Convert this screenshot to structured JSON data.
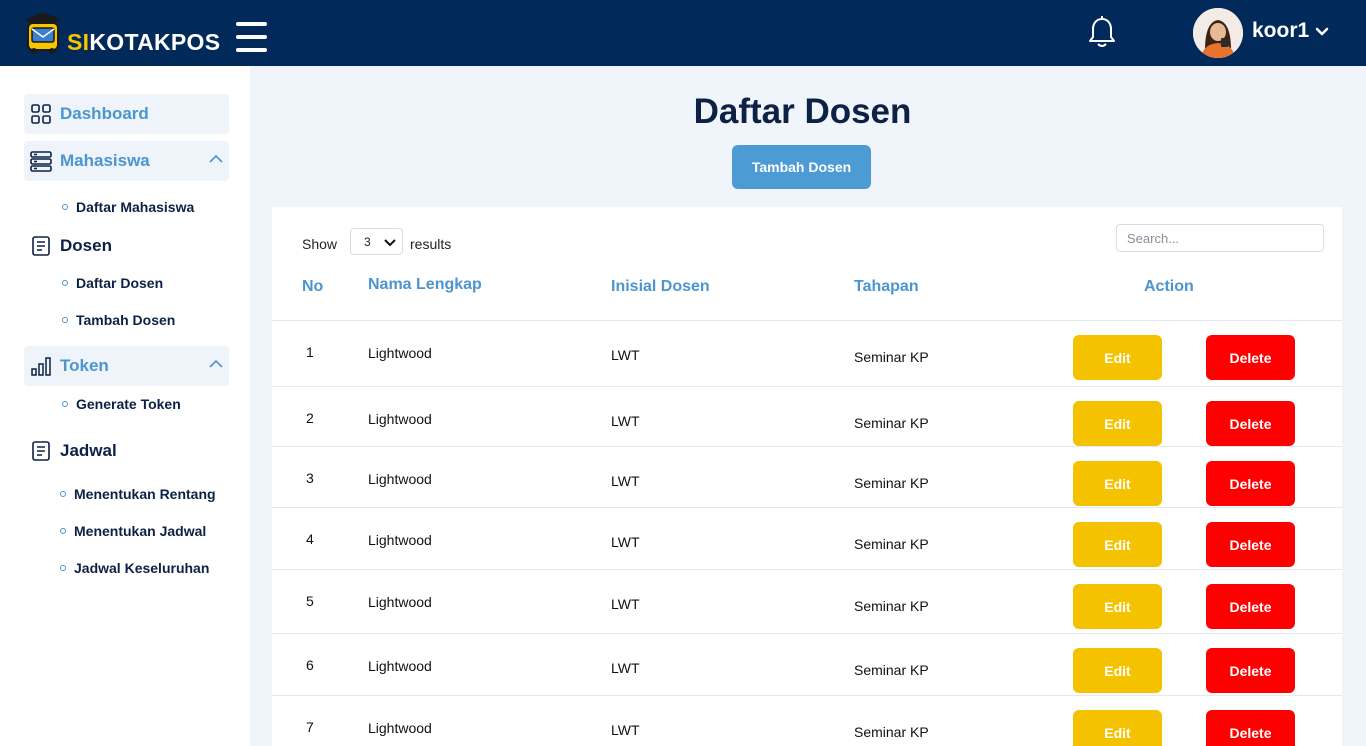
{
  "header": {
    "brand_prefix": "SI",
    "brand_suffix": "KOTAKPOS",
    "username": "koor1",
    "colors": {
      "bar": "#012a5a",
      "brand_accent": "#f7c600"
    }
  },
  "sidebar": {
    "dashboard": "Dashboard",
    "mahasiswa": "Mahasiswa",
    "mahasiswa_sub": [
      "Daftar Mahasiswa"
    ],
    "dosen": "Dosen",
    "dosen_sub": [
      "Daftar Dosen",
      "Tambah Dosen"
    ],
    "token": "Token",
    "token_sub": [
      "Generate Token"
    ],
    "jadwal": "Jadwal",
    "jadwal_sub": [
      "Menentukan Rentang",
      "Menentukan Jadwal",
      "Jadwal Keseluruhan"
    ]
  },
  "main": {
    "title": "Daftar Dosen",
    "add_button": "Tambah Dosen",
    "show_label": "Show",
    "page_size": "3",
    "results_label": "results",
    "search_placeholder": "Search...",
    "columns": [
      "No",
      "Nama Lengkap",
      "Inisial Dosen",
      "Tahapan",
      "Action"
    ],
    "edit_label": "Edit",
    "delete_label": "Delete",
    "rows": [
      {
        "no": "1",
        "nama": "Lightwood",
        "inisial": "LWT",
        "tahapan": "Seminar KP"
      },
      {
        "no": "2",
        "nama": "Lightwood",
        "inisial": "LWT",
        "tahapan": "Seminar KP"
      },
      {
        "no": "3",
        "nama": "Lightwood",
        "inisial": "LWT",
        "tahapan": "Seminar KP"
      },
      {
        "no": "4",
        "nama": "Lightwood",
        "inisial": "LWT",
        "tahapan": "Seminar KP"
      },
      {
        "no": "5",
        "nama": "Lightwood",
        "inisial": "LWT",
        "tahapan": "Seminar KP"
      },
      {
        "no": "6",
        "nama": "Lightwood",
        "inisial": "LWT",
        "tahapan": "Seminar KP"
      },
      {
        "no": "7",
        "nama": "Lightwood",
        "inisial": "LWT",
        "tahapan": "Seminar KP"
      }
    ],
    "colors": {
      "accent": "#4c95cf",
      "edit": "#f5c200",
      "delete": "#ff0000",
      "title": "#0d2145"
    }
  },
  "icons": [
    "mailbox-bus-logo-icon",
    "hamburger-icon",
    "bell-icon",
    "avatar",
    "chevron-down-icon",
    "grid-icon",
    "server-icon",
    "document-icon",
    "bar-chart-icon",
    "chevron-up-icon"
  ]
}
